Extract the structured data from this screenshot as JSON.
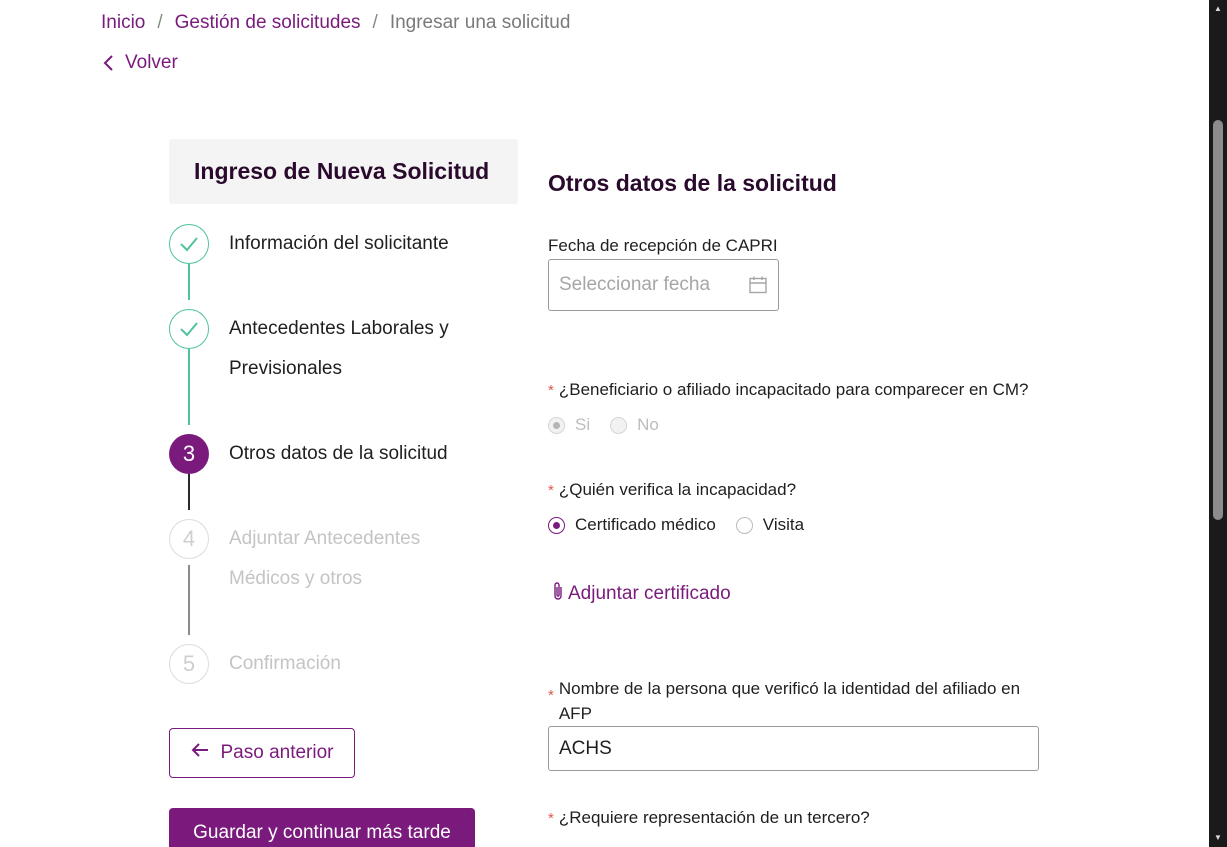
{
  "breadcrumb": {
    "items": [
      "Inicio",
      "Gestión de solicitudes"
    ],
    "current": "Ingresar una solicitud",
    "separator": "/"
  },
  "back_label": "Volver",
  "sidebar": {
    "title": "Ingreso de Nueva Solicitud",
    "steps": [
      {
        "label": "Información del solicitante",
        "status": "done"
      },
      {
        "label": "Antecedentes Laborales y",
        "label2": "Previsionales",
        "status": "done"
      },
      {
        "number": "3",
        "label": "Otros datos de la solicitud",
        "status": "active"
      },
      {
        "number": "4",
        "label": "Adjuntar Antecedentes",
        "label2": "Médicos y otros",
        "status": "pending"
      },
      {
        "number": "5",
        "label": "Confirmación",
        "status": "pending"
      }
    ],
    "prev_button": "Paso anterior",
    "save_button": "Guardar y continuar más tarde"
  },
  "form": {
    "section_title": "Otros datos de la solicitud",
    "fecha": {
      "label": "Fecha de recepción de CAPRI",
      "placeholder": "Seleccionar fecha"
    },
    "incapacitado": {
      "label": "¿Beneficiario o afiliado incapacitado para comparecer en CM?",
      "options": [
        "Si",
        "No"
      ],
      "selected": "Si",
      "disabled": true
    },
    "verifica": {
      "label": "¿Quién verifica la incapacidad?",
      "options": [
        "Certificado médico",
        "Visita"
      ],
      "selected": "Certificado médico"
    },
    "attach_label": "Adjuntar certificado",
    "nombre": {
      "label_line1": "Nombre de la persona que verificó la identidad del afiliado en",
      "label_line2": "AFP",
      "value": "ACHS"
    },
    "representacion": {
      "label": "¿Requiere representación de un tercero?"
    }
  },
  "colors": {
    "brand": "#7a1a7d",
    "success": "#4fc3a1",
    "required": "#e0584f"
  }
}
